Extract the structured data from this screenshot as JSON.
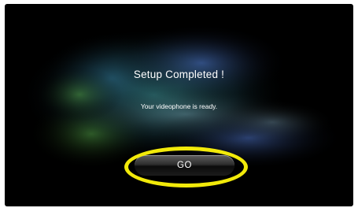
{
  "dialog": {
    "title": "Setup Completed !",
    "message": "Your videophone is ready.",
    "go_label": "GO"
  },
  "colors": {
    "screen_background": "#000000",
    "text": "#ffffff",
    "highlight_ring": "#f2ea0a",
    "glow_teal": "#2f8f8f",
    "glow_blue": "#3a5fae",
    "glow_green": "#3f8a3a"
  },
  "icons": {
    "highlight": "yellow-ellipse-highlight"
  }
}
